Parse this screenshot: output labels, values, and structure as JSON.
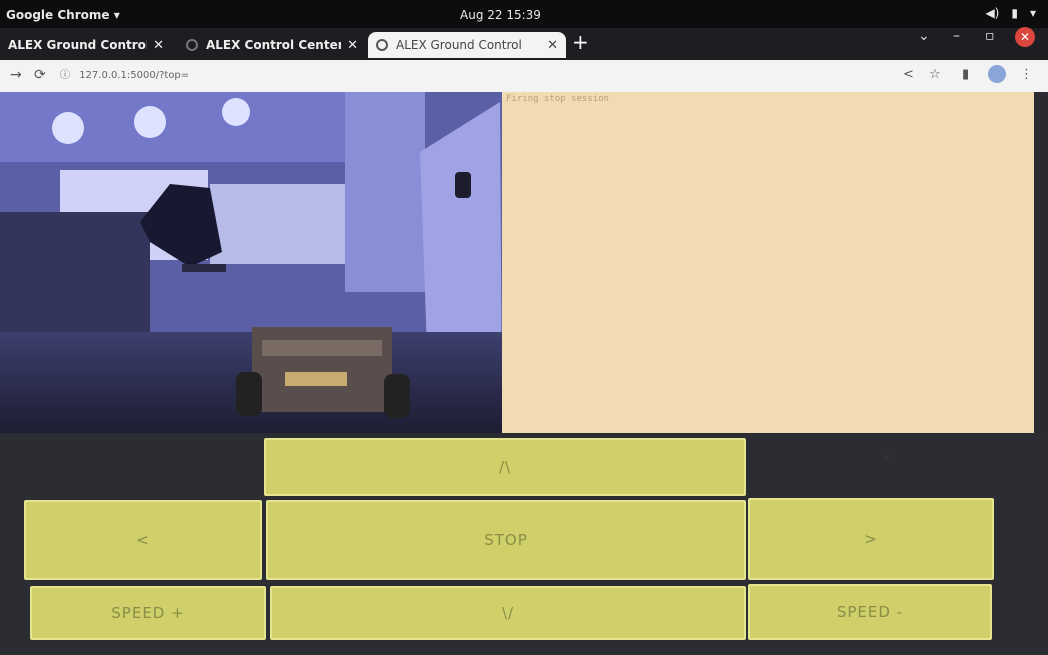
{
  "system": {
    "app_menu": "Google Chrome ▾",
    "clock": "Aug 22  15:39",
    "tray": [
      "◀)",
      "▮",
      "▾"
    ]
  },
  "browser": {
    "tabs": [
      {
        "title": "ALEX Ground Control",
        "active": false
      },
      {
        "title": "ALEX Control Center",
        "active": false
      },
      {
        "title": "ALEX Ground Control",
        "active": true
      }
    ],
    "new_tab": "+",
    "url": "127.0.0.1:5000/?top=",
    "window_controls": [
      "⌄",
      "–",
      "▫"
    ],
    "toolbar_icons": [
      "share-icon",
      "bookmark-star-icon",
      "side-panel-icon",
      "profile-icon",
      "menu-icon"
    ]
  },
  "terminal": {
    "first_line": "Firing stop session"
  },
  "controls": {
    "forward": "/\\",
    "left": "<",
    "stop": "STOP",
    "right": ">",
    "speed_up": "SPEED +",
    "backward": "\\/",
    "speed_down": "SPEED -"
  },
  "colors": {
    "button": "#cfd06a",
    "terminal_bg": "#f1dbb3"
  }
}
